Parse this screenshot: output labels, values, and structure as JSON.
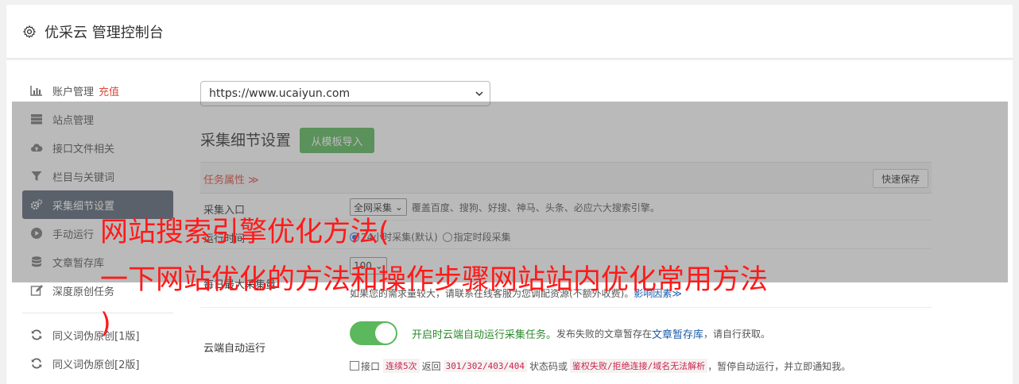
{
  "header": {
    "title": "优采云 管理控制台",
    "icon": "gear-icon"
  },
  "sidebar": {
    "items": [
      {
        "label": "账户管理",
        "badge": "充值",
        "icon": "bar-chart-icon"
      },
      {
        "label": "站点管理",
        "icon": "server-icon"
      },
      {
        "label": "接口文件相关",
        "icon": "cloud-upload-icon"
      },
      {
        "label": "栏目与关键词",
        "icon": "filter-icon"
      },
      {
        "label": "采集细节设置",
        "icon": "gears-icon"
      },
      {
        "label": "手动运行",
        "icon": "play-icon"
      },
      {
        "label": "文章暂存库",
        "icon": "database-icon"
      },
      {
        "label": "深度原创任务",
        "icon": "edit-icon"
      },
      {
        "label": "同义词伪原创[1版]",
        "icon": "refresh-icon"
      },
      {
        "label": "同义词伪原创[2版]",
        "icon": "refresh-icon"
      }
    ],
    "active_index": 4
  },
  "content": {
    "site_select": "https://www.ucaiyun.com",
    "section_title": "采集细节设置",
    "template_button": "从模板导入",
    "task_attr_label": "任务属性 ≫",
    "quick_save": "快速保存",
    "rows": {
      "entry": {
        "label": "采集入口",
        "select": "全网采集",
        "hint": "覆盖百度、搜狗、好搜、神马、头条、必应六大搜索引擎。"
      },
      "time": {
        "label": "运行时间",
        "opt1": "24小时采集(默认)",
        "opt2": "指定时段采集"
      },
      "daily": {
        "label": "每日最大采集量",
        "select": "100",
        "hint": "如果您的需求量较大，请联系在线客服为您调配资源(不额外收费)。",
        "link": "影响因素≫"
      },
      "cloud": {
        "label": "云端自动运行",
        "toggle_on": true,
        "text_green": "开启时云端自动运行采集任务。",
        "text_rest": "发布失败的文章暂存在",
        "text_link": "文章暂存库",
        "text_end": "，请自行获取。",
        "cb_a": "接口",
        "code1": "连续5次",
        "cb_b": "返回",
        "code2": "301/302/403/404",
        "cb_c": "状态码或",
        "code3": "鉴权失败/拒绝连接/域名无法解析",
        "cb_d": "，暂停自动运行，并立即通知我。"
      }
    }
  },
  "watermark": {
    "line1": "网站搜索引擎优化方法(",
    "line2": "一下网站优化的方法和操作步骤网站站内优化常用方法",
    "line3": ")"
  },
  "colors": {
    "accent": "#5cb85c",
    "danger": "#e14b3b",
    "watermark": "#ff1a1a",
    "active": "#5b6775"
  }
}
